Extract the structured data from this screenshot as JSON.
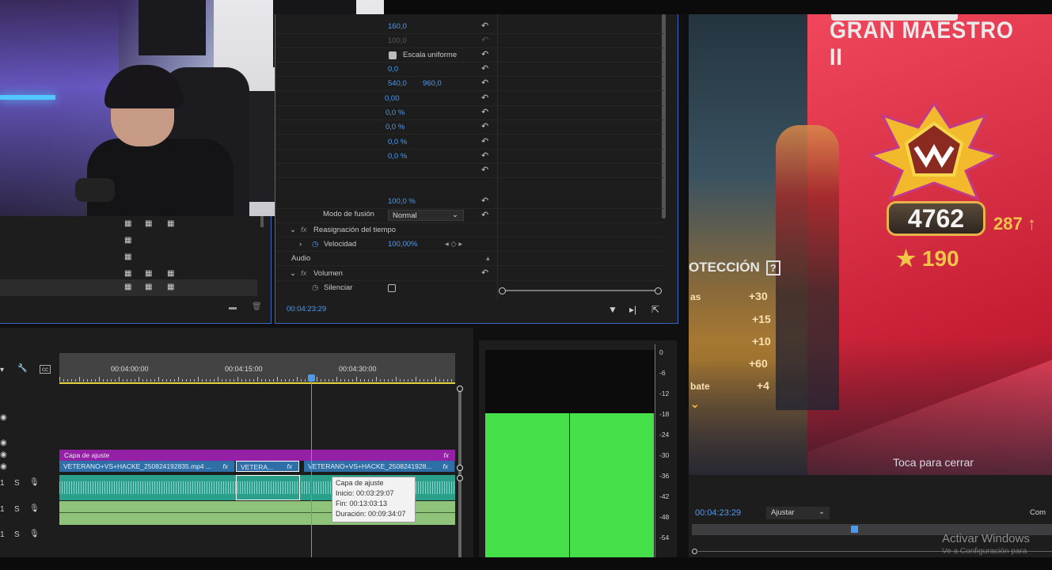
{
  "effect_controls": {
    "rows": [
      {
        "v1": "160,0"
      },
      {
        "v1": "100,0"
      },
      {
        "label": "Escala uniforme"
      },
      {
        "v1": "0,0"
      },
      {
        "v1": "540,0",
        "v2": "960,0"
      },
      {
        "v1": "0,00"
      },
      {
        "v1": "0,0 %"
      },
      {
        "v1": "0,0 %"
      },
      {
        "v1": "0,0 %"
      },
      {
        "v1": "0,0 %"
      },
      {
        "v1": ""
      },
      {
        "v1": "100,0 %"
      }
    ],
    "blend_label": "Modo de fusión",
    "blend_value": "Normal",
    "time_remap": "Reasignación del tiempo",
    "speed_label": "Velocidad",
    "speed_value": "100,00%",
    "audio_header": "Audio",
    "volume_label": "Volumen",
    "mute_label": "Silenciar",
    "timecode": "00:04:23:29",
    "fx_glyph": "fx"
  },
  "timeline": {
    "ruler": [
      "00:04:00:00",
      "00:04:15:00",
      "00:04:30:00"
    ],
    "adjustment_clip": "Capa de ajuste",
    "clip1": "VETERANO+VS+HACKE_250824192835.mp4 ...",
    "clip2": "VETERA...",
    "clip3": "VETERANO+VS+HACKE_2508241928...",
    "fx": "fx",
    "track_s": "S",
    "tooltip": {
      "title": "Capa de ajuste",
      "start": "Inicio: 00:03:29:07",
      "end": "Fin: 00:13:03:13",
      "duration": "Duración: 00:09:34:07"
    }
  },
  "meter": {
    "scale": [
      "0",
      "-6",
      "-12",
      "-18",
      "-24",
      "-30",
      "-36",
      "-42",
      "-48",
      "-54"
    ]
  },
  "program": {
    "rank_title": "GRAN MAESTRO II",
    "points": "4762",
    "delta": "287",
    "stars": "190",
    "protection": "OTECCIÓN",
    "bonus_labels": [
      "as",
      "bate"
    ],
    "bonuses": [
      "+30",
      "+15",
      "+10",
      "+60",
      "+4"
    ],
    "tap_to_close": "Toca para cerrar",
    "timecode": "00:04:23:29",
    "fit": "Ajustar",
    "com": "Com",
    "watermark": "Activar Windows",
    "watermark_sub": "Ve a Configuración para"
  },
  "colors": {
    "accent": "#4d9bf0",
    "adjustment_clip": "#9420a6",
    "video_clip": "#2f6fa8",
    "meter_green": "#45e04a"
  }
}
